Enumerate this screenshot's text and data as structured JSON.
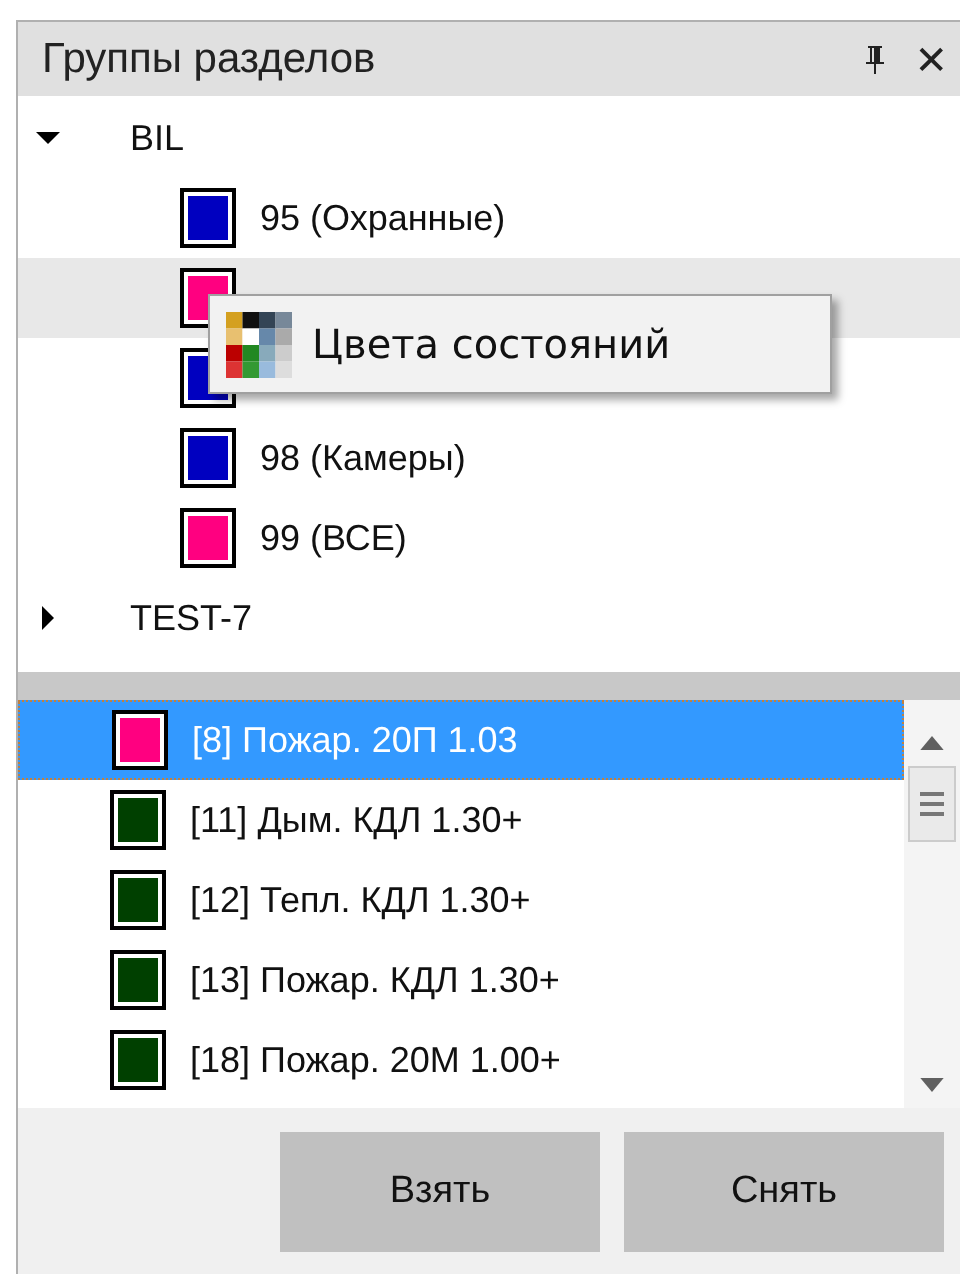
{
  "panel": {
    "title": "Группы разделов",
    "close_icon": "✕"
  },
  "tree": [
    {
      "label": "BIL",
      "expanded": true,
      "children": [
        {
          "label": "95 (Охранные)",
          "color": "#0000c0",
          "highlighted": false
        },
        {
          "color": "#ff0080",
          "highlighted": true
        },
        {
          "color": "#0000c0",
          "highlighted": false
        },
        {
          "label": "98 (Камеры)",
          "color": "#0000c0",
          "highlighted": false
        },
        {
          "label": "99 (ВСЕ)",
          "color": "#ff0080",
          "highlighted": false
        }
      ]
    },
    {
      "label": "TEST-7",
      "expanded": false
    }
  ],
  "context_menu": {
    "items": [
      "Цвета состояний"
    ]
  },
  "list": [
    {
      "label": "[8] Пожар. 20П 1.03",
      "color": "#ff0080",
      "selected": true
    },
    {
      "label": "[11] Дым. КДЛ 1.30+",
      "color": "#004000",
      "selected": false
    },
    {
      "label": "[12] Тепл. КДЛ 1.30+",
      "color": "#004000",
      "selected": false
    },
    {
      "label": "[13] Пожар. КДЛ 1.30+",
      "color": "#004000",
      "selected": false
    },
    {
      "label": "[18] Пожар. 20М 1.00+",
      "color": "#004000",
      "selected": false
    }
  ],
  "buttons": [
    "Взять",
    "Снять"
  ]
}
